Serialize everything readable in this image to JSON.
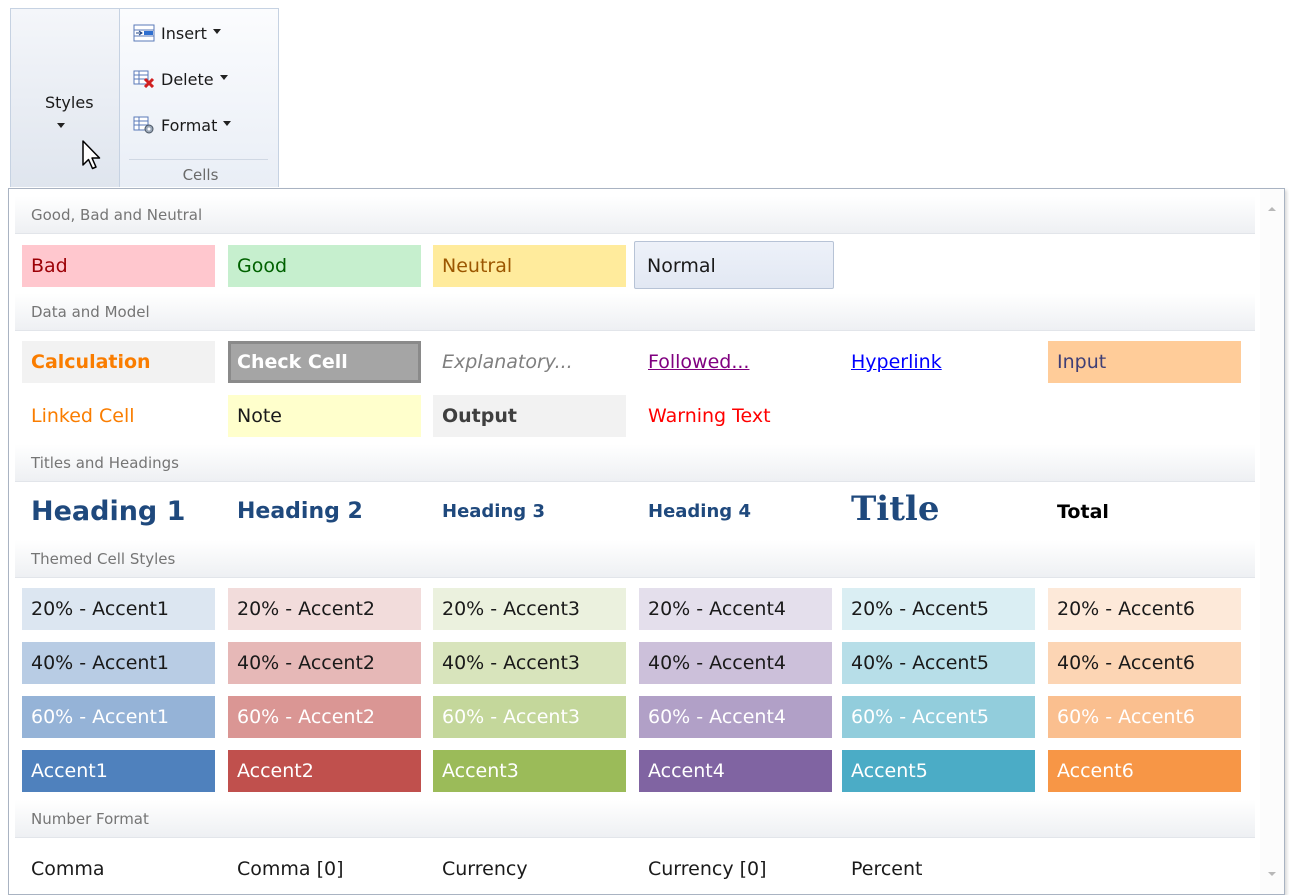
{
  "ribbon": {
    "styles_label": "Styles",
    "cells_group_label": "Cells",
    "insert_label": "Insert",
    "delete_label": "Delete",
    "format_label": "Format"
  },
  "gallery": {
    "sections": {
      "good_bad_neutral": "Good, Bad and Neutral",
      "data_model": "Data and Model",
      "titles_headings": "Titles and Headings",
      "themed": "Themed Cell Styles",
      "number_format": "Number Format"
    },
    "gbn": {
      "bad": "Bad",
      "good": "Good",
      "neutral": "Neutral",
      "normal": "Normal"
    },
    "data": {
      "calculation": "Calculation",
      "check_cell": "Check Cell",
      "explanatory": "Explanatory...",
      "followed": "Followed...",
      "hyperlink": "Hyperlink",
      "input": "Input",
      "linked_cell": "Linked Cell",
      "note": "Note",
      "output": "Output",
      "warning": "Warning Text"
    },
    "titles": {
      "h1": "Heading 1",
      "h2": "Heading 2",
      "h3": "Heading 3",
      "h4": "Heading 4",
      "title": "Title",
      "total": "Total"
    },
    "themed": {
      "r20": [
        "20% - Accent1",
        "20% - Accent2",
        "20% - Accent3",
        "20% - Accent4",
        "20% - Accent5",
        "20% - Accent6"
      ],
      "r40": [
        "40% - Accent1",
        "40% - Accent2",
        "40% - Accent3",
        "40% - Accent4",
        "40% - Accent5",
        "40% - Accent6"
      ],
      "r60": [
        "60% - Accent1",
        "60% - Accent2",
        "60% - Accent3",
        "60% - Accent4",
        "60% - Accent5",
        "60% - Accent6"
      ],
      "r100": [
        "Accent1",
        "Accent2",
        "Accent3",
        "Accent4",
        "Accent5",
        "Accent6"
      ]
    },
    "number": {
      "comma": "Comma",
      "comma0": "Comma [0]",
      "currency": "Currency",
      "currency0": "Currency [0]",
      "percent": "Percent"
    }
  },
  "colors": {
    "accent1": "#4f81bd",
    "accent2": "#c0504d",
    "accent3": "#9bbb59",
    "accent4": "#8064a2",
    "accent5": "#4bacc6",
    "accent6": "#f79646",
    "heading": "#1f497d"
  }
}
